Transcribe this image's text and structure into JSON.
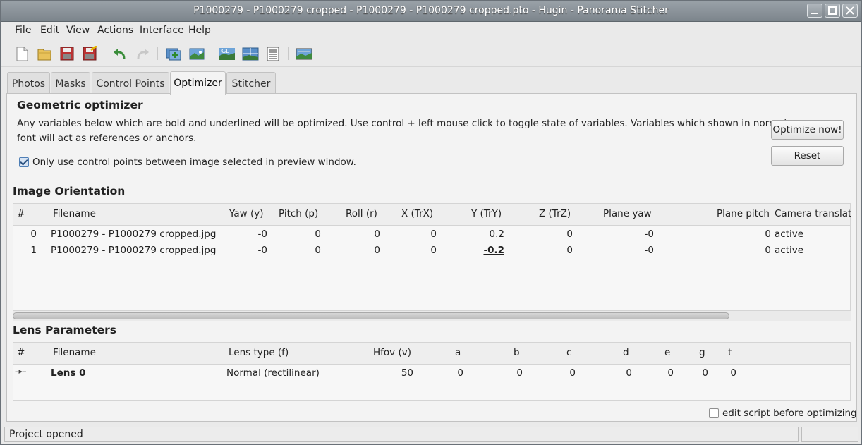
{
  "window": {
    "title": "P1000279 - P1000279 cropped - P1000279 - P1000279 cropped.pto - Hugin - Panorama Stitcher"
  },
  "menu": [
    "File",
    "Edit",
    "View",
    "Actions",
    "Interface",
    "Help"
  ],
  "toolbar": {
    "icons": [
      "new-project-icon",
      "open-icon",
      "save-icon",
      "save-as-icon",
      "undo-icon",
      "redo-icon",
      "add-images-icon",
      "add-time-series-icon",
      "fast-preview-gl-icon",
      "preview-icon",
      "layout-icon",
      "assistant-icon"
    ]
  },
  "tabs": [
    "Photos",
    "Masks",
    "Control Points",
    "Optimizer",
    "Stitcher"
  ],
  "active_tab": "Optimizer",
  "optimizer": {
    "heading": "Geometric optimizer",
    "description_line1": "Any variables below which are bold and underlined will be optimized. Use control + left mouse click to toggle state of variables. Variables which shown in normal",
    "description_line2": "font will act as references or anchors.",
    "only_selected_label": "Only use control points between image selected in preview window.",
    "only_selected_checked": true,
    "optimize_button": "Optimize now!",
    "reset_button": "Reset"
  },
  "image_orientation": {
    "heading": "Image Orientation",
    "columns": [
      "#",
      "Filename",
      "Yaw (y)",
      "Pitch (p)",
      "Roll (r)",
      "X (TrX)",
      "Y (TrY)",
      "Z (TrZ)",
      "Plane yaw",
      "Plane pitch",
      "Camera translatio"
    ],
    "rows": [
      {
        "num": "0",
        "filename": "P1000279 - P1000279 cropped.jpg",
        "yaw": "-0",
        "pitch": "0",
        "roll": "0",
        "x": "0",
        "y": "0.2",
        "z": "0",
        "plane_yaw": "-0",
        "plane_pitch": "0",
        "cam": "active"
      },
      {
        "num": "1",
        "filename": "P1000279 - P1000279 cropped.jpg",
        "yaw": "-0",
        "pitch": "0",
        "roll": "0",
        "x": "0",
        "y": "-0.2",
        "z": "0",
        "plane_yaw": "-0",
        "plane_pitch": "0",
        "cam": "active"
      }
    ]
  },
  "lens_parameters": {
    "heading": "Lens Parameters",
    "columns": [
      "#",
      "Filename",
      "Lens type (f)",
      "Hfov (v)",
      "a",
      "b",
      "c",
      "d",
      "e",
      "g",
      "t"
    ],
    "rows": [
      {
        "expander": "–▸–",
        "filename": "Lens 0",
        "lens_type": "Normal (rectilinear)",
        "hfov": "50",
        "a": "0",
        "b": "0",
        "c": "0",
        "d": "0",
        "e": "0",
        "g": "0",
        "t": "0"
      }
    ]
  },
  "edit_script": {
    "label": "edit script before optimizing",
    "checked": false
  },
  "status": {
    "text": "Project opened"
  }
}
